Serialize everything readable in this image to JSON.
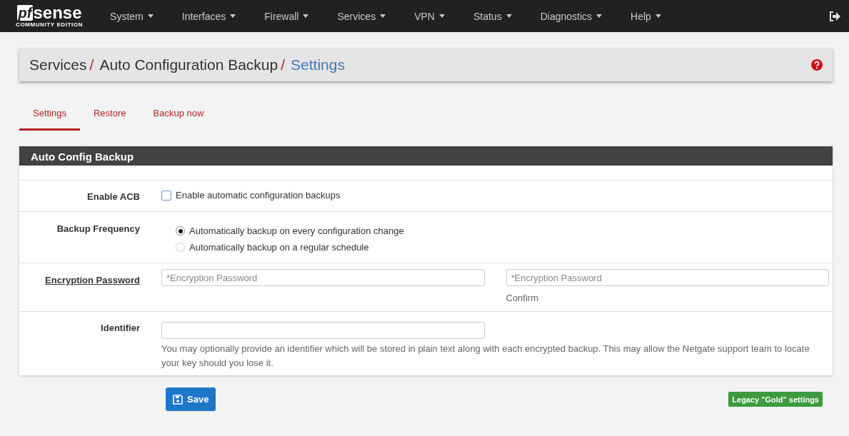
{
  "logo": {
    "mark": "pf",
    "word": "sense",
    "edition": "COMMUNITY EDITION"
  },
  "nav": [
    {
      "label": "System"
    },
    {
      "label": "Interfaces"
    },
    {
      "label": "Firewall"
    },
    {
      "label": "Services"
    },
    {
      "label": "VPN"
    },
    {
      "label": "Status"
    },
    {
      "label": "Diagnostics"
    },
    {
      "label": "Help"
    }
  ],
  "breadcrumb": [
    "Services",
    "Auto Configuration Backup",
    "Settings"
  ],
  "breadcrumb_separators": [
    "/",
    "/"
  ],
  "tabs": [
    {
      "label": "Settings",
      "selected": true
    },
    {
      "label": "Restore",
      "selected": false
    },
    {
      "label": "Backup now",
      "selected": false
    }
  ],
  "panel": {
    "title": "Auto Config Backup",
    "rows": [
      {
        "kind": "checkbox",
        "label": "Enable ACB",
        "text": "Enable automatic configuration backups",
        "checked": false
      },
      {
        "kind": "radio",
        "label": "Backup Frequency",
        "options": [
          {
            "text": "Automatically backup on every configuration change",
            "selected": true
          },
          {
            "text": "Automatically backup on a regular schedule",
            "selected": false
          }
        ]
      },
      {
        "kind": "password",
        "label": "Encryption Password",
        "placeholder": "*Encryption Password",
        "confirm_placeholder": "*Encryption Password",
        "confirm_hint": "Confirm"
      },
      {
        "kind": "text",
        "label": "Identifier",
        "help": "You may optionally provide an identifier which will be stored in plain text along with each encrypted backup. This may allow the Netgate support team to locate your key should you lose it."
      }
    ]
  },
  "save_button": "Save",
  "legacy_button": "Legacy \"Gold\" settings"
}
